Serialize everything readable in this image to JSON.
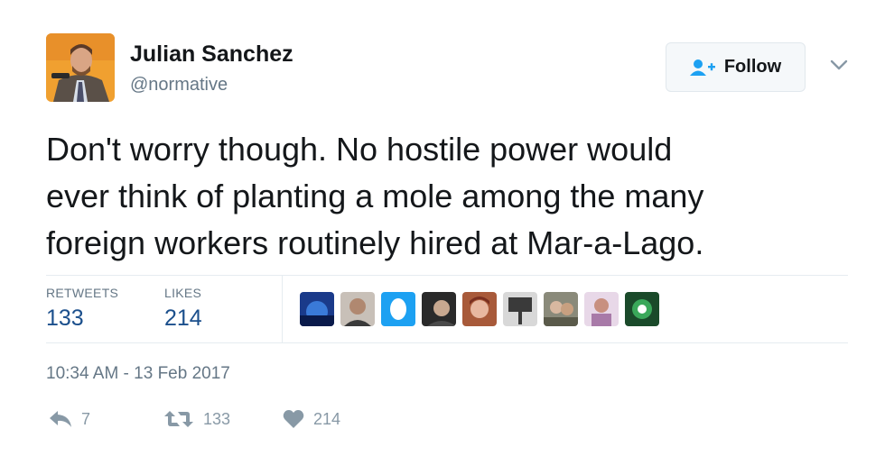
{
  "author": {
    "name": "Julian Sanchez",
    "handle": "@normative"
  },
  "follow_button": {
    "label": "Follow"
  },
  "tweet": {
    "lines": [
      "Don't worry though. No hostile power would",
      "ever think of planting a mole among the many",
      "foreign workers routinely hired at Mar-a-Lago."
    ]
  },
  "stats": {
    "retweets_label": "RETWEETS",
    "retweets_value": "133",
    "likes_label": "LIKES",
    "likes_value": "214"
  },
  "likers": [
    "liker-1",
    "liker-2",
    "liker-3",
    "liker-4",
    "liker-5",
    "liker-6",
    "liker-7",
    "liker-8",
    "liker-9"
  ],
  "timestamp": "10:34 AM - 13 Feb 2017",
  "actions": {
    "reply_count": "7",
    "retweet_count": "133",
    "like_count": "214"
  },
  "colors": {
    "link_blue": "#1b4f8c",
    "muted_gray": "#657786",
    "icon_gray": "#8899a6"
  }
}
